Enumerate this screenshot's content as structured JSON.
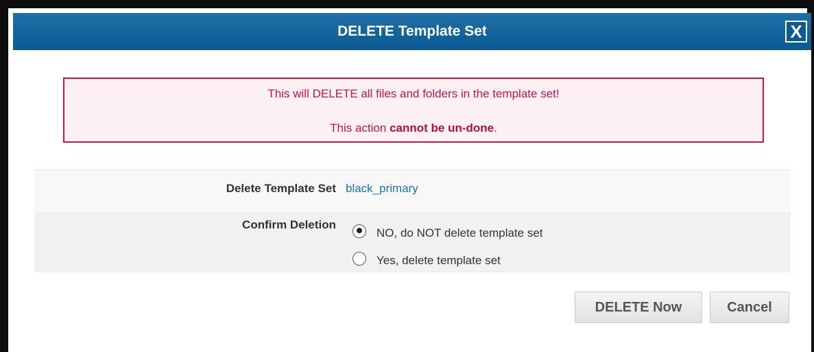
{
  "dialog": {
    "title": "DELETE Template Set",
    "close_label": "X"
  },
  "warning": {
    "line1": "This will DELETE all files and folders in the template set!",
    "line2_prefix": "This action ",
    "line2_emphasis": "cannot be un-done",
    "line2_suffix": "."
  },
  "form": {
    "template_label": "Delete Template Set",
    "template_value": "black_primary",
    "confirm_label": "Confirm Deletion",
    "options": [
      {
        "label": "NO, do NOT delete template set",
        "selected": true
      },
      {
        "label": "Yes, delete template set",
        "selected": false
      }
    ]
  },
  "buttons": {
    "delete_label": "DELETE Now",
    "cancel_label": "Cancel"
  },
  "colors": {
    "titlebar": "#0b5b92",
    "warning_text": "#c9134e",
    "link": "#1b74a8"
  }
}
